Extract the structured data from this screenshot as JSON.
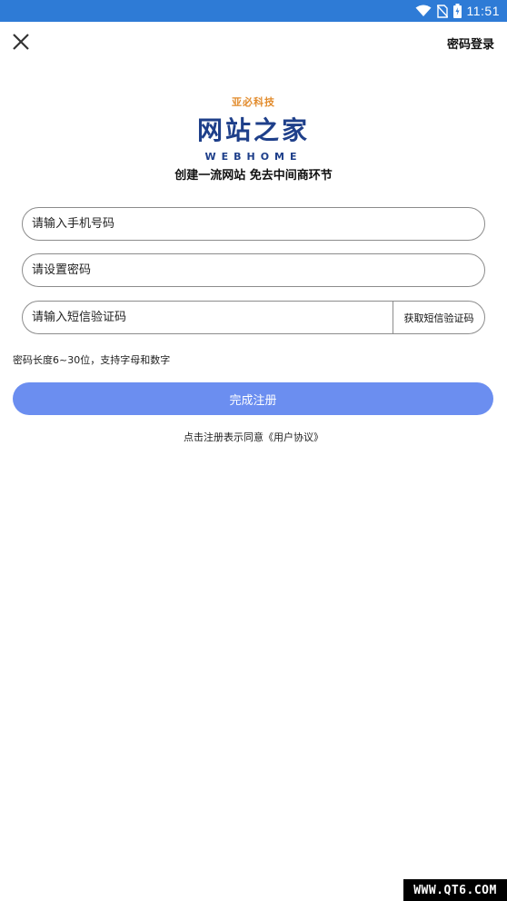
{
  "status_bar": {
    "time": "11:51"
  },
  "header": {
    "password_login": "密码登录"
  },
  "logo": {
    "top_text": "亚必科技",
    "main_text": "网站之家",
    "sub_text": "WEBHOME"
  },
  "slogan": "创建一流网站 免去中间商环节",
  "form": {
    "phone_placeholder": "请输入手机号码",
    "password_placeholder": "请设置密码",
    "sms_placeholder": "请输入短信验证码",
    "get_code_label": "获取短信验证码"
  },
  "hint": "密码长度6~30位，支持字母和数字",
  "submit_label": "完成注册",
  "agreement": "点击注册表示同意《用户协议》",
  "watermark": "WWW.QT6.COM",
  "colors": {
    "status_bar": "#2e7bd6",
    "primary_button": "#6b8ef0",
    "logo_blue": "#1e3f8a",
    "logo_orange": "#e28b2c"
  }
}
